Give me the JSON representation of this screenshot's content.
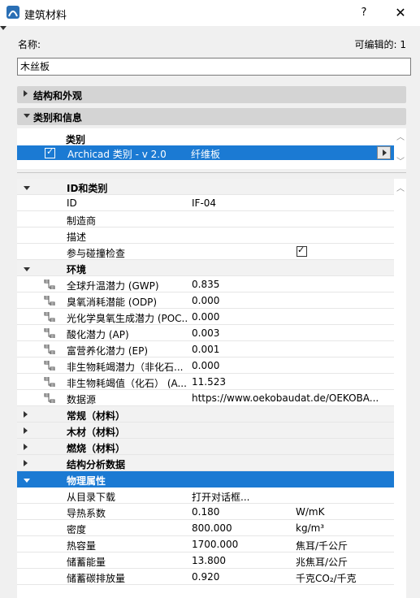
{
  "window": {
    "title": "建筑材料",
    "help_label": "?",
    "close_label": "✕"
  },
  "header": {
    "name_label": "名称:",
    "editable_label": "可编辑的:",
    "editable_count": "1"
  },
  "name_field": {
    "value": "木丝板"
  },
  "sections": {
    "structure": "结构和外观",
    "category_info": "类别和信息"
  },
  "category_table": {
    "header": "类别",
    "row": {
      "name": "Archicad 类别 - v 2.0",
      "value": "纤维板",
      "checked": true
    }
  },
  "properties": {
    "group_id": "ID和类别",
    "id_rows": [
      {
        "name": "ID",
        "value": "IF-04"
      },
      {
        "name": "制造商",
        "value": ""
      },
      {
        "name": "描述",
        "value": ""
      },
      {
        "name": "参与碰撞检查",
        "value": ""
      }
    ],
    "clash_checked": true,
    "group_env": "环境",
    "env_rows": [
      {
        "name": "全球升温潜力 (GWP)",
        "value": "0.835"
      },
      {
        "name": "臭氧消耗潜能 (ODP)",
        "value": "0.000"
      },
      {
        "name": "光化学臭氧生成潜力 (POC...",
        "value": "0.000"
      },
      {
        "name": "酸化潜力 (AP)",
        "value": "0.003"
      },
      {
        "name": "富营养化潜力 (EP)",
        "value": "0.001"
      },
      {
        "name": "非生物耗竭潜力（非化石...",
        "value": "0.000"
      },
      {
        "name": "非生物耗竭值（化石） (A...",
        "value": "11.523"
      },
      {
        "name": "数据源",
        "value": "https://www.oekobaudat.de/OEKOBA..."
      }
    ],
    "collapsed_groups": [
      "常规（材料）",
      "木材（材料）",
      "燃烧（材料）",
      "结构分析数据"
    ],
    "group_phys": "物理属性",
    "phys_rows": [
      {
        "name": "从目录下载",
        "value": "打开对话框...",
        "unit": ""
      },
      {
        "name": "导热系数",
        "value": "0.180",
        "unit": "W/mK"
      },
      {
        "name": "密度",
        "value": "800.000",
        "unit": "kg/m³"
      },
      {
        "name": "热容量",
        "value": "1700.000",
        "unit": "焦耳/千公斤"
      },
      {
        "name": "储蓄能量",
        "value": "13.800",
        "unit": "兆焦耳/公斤"
      },
      {
        "name": "储蓄碳排放量",
        "value": "0.920",
        "unit": "千克CO₂/千克"
      }
    ]
  },
  "colors": {
    "selection": "#1b7ad3",
    "section_bar": "#d4d4d4"
  }
}
